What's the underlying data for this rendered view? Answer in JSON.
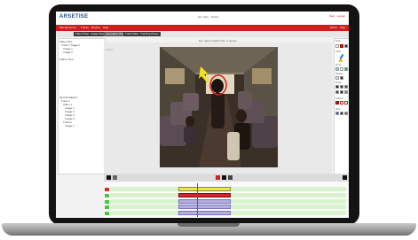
{
  "app": {
    "logo": "ARSETISE",
    "center_info": "Ext. rigid · Tracks",
    "user": "User · Logout"
  },
  "menu": {
    "items": [
      "Manual Annot.",
      "Tracks",
      "Review",
      "Help"
    ],
    "right": "Admin · Help"
  },
  "tabs": [
    "Video Player",
    "Image Player",
    "Annotation Player",
    "Track Manager",
    "Tracking Player"
  ],
  "left_tree": {
    "sections": [
      "Video Tree",
      "Frame Tree",
      "All Annotations"
    ],
    "items": [
      "Track 1 Tagged",
      "Image 1",
      "Image 2",
      "Track 1",
      "Video 1",
      "Image 1",
      "Image 2",
      "Image 3",
      "Image 4",
      "Track 2",
      "Image 1"
    ]
  },
  "video": {
    "title": "Ext. rigid, Crowd Train, 1 person",
    "side_note": "Annot."
  },
  "right_panel": {
    "labels": [
      "Tools",
      "Color",
      "Annot.",
      "Shapes",
      "Props",
      "Actions",
      "View"
    ]
  },
  "controls": {
    "buttons": [
      "prev",
      "play",
      "pause",
      "next"
    ]
  },
  "timeline": {
    "rows": [
      {
        "track": "track-1",
        "segments": [
          {
            "start": 0.29,
            "end": 0.51,
            "color": "#ece45a",
            "border": "#8a8a2a"
          }
        ]
      },
      {
        "track": "track-2",
        "segments": [
          {
            "start": 0.29,
            "end": 0.51,
            "color": "#d6242a",
            "border": "#7b1216"
          }
        ]
      },
      {
        "track": "track-3",
        "segments": [
          {
            "start": 0.29,
            "end": 0.51,
            "color": "#b3aee0",
            "border": "#7a73b8"
          }
        ]
      },
      {
        "track": "track-4",
        "segments": [
          {
            "start": 0.29,
            "end": 0.51,
            "color": "#b3aee0",
            "border": "#7a73b8"
          }
        ]
      },
      {
        "track": "track-5",
        "segments": [
          {
            "start": 0.29,
            "end": 0.51,
            "color": "#b3aee0",
            "border": "#7a73b8"
          }
        ]
      }
    ],
    "playhead": 0.37,
    "colors": {
      "track_band": "#d9f2cf",
      "marker_green": "#4fc244",
      "marker_red": "#d62a2a"
    }
  }
}
